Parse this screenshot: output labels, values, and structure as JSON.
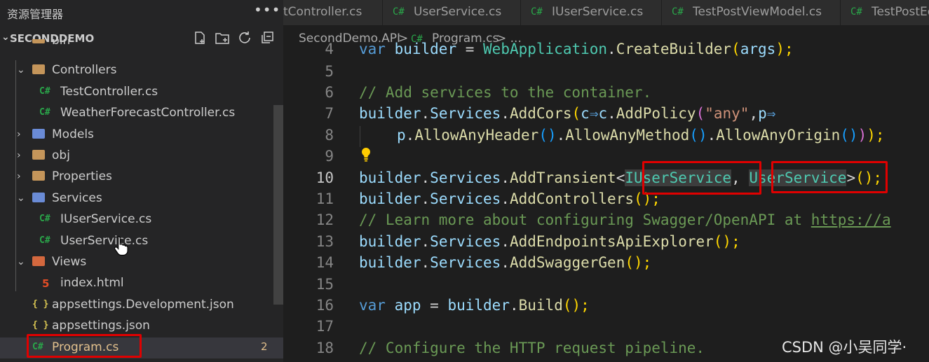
{
  "explorer": {
    "title": "资源管理器",
    "more_icon": "•••",
    "project": "SECONDDEMO",
    "header_icons": [
      "new-file-icon",
      "new-folder-icon",
      "refresh-icon",
      "collapse-all-icon"
    ],
    "items": [
      {
        "label": "bin",
        "type": "folder"
      },
      {
        "label": "Controllers",
        "type": "folder"
      },
      {
        "label": "TestController.cs",
        "type": "cs"
      },
      {
        "label": "WeatherForecastController.cs",
        "type": "cs"
      },
      {
        "label": "Models",
        "type": "folder"
      },
      {
        "label": "obj",
        "type": "folder"
      },
      {
        "label": "Properties",
        "type": "folder"
      },
      {
        "label": "Services",
        "type": "folder"
      },
      {
        "label": "IUserService.cs",
        "type": "cs"
      },
      {
        "label": "UserService.cs",
        "type": "cs"
      },
      {
        "label": "Views",
        "type": "folder"
      },
      {
        "label": "index.html",
        "type": "html"
      },
      {
        "label": "appsettings.Development.json",
        "type": "json"
      },
      {
        "label": "appsettings.json",
        "type": "json"
      },
      {
        "label": "Program.cs",
        "type": "cs",
        "badge": "2"
      }
    ],
    "cs_glyph": "C#",
    "json_glyph": "{ }",
    "html_glyph": "5"
  },
  "tabs": [
    {
      "label": "tController.cs"
    },
    {
      "label": "UserService.cs"
    },
    {
      "label": "IUserService.cs"
    },
    {
      "label": "TestPostViewModel.cs"
    },
    {
      "label": "TestPostEd"
    }
  ],
  "breadcrumb": {
    "project": "SecondDemo.API",
    "sep": ">",
    "file": "Program.cs",
    "tail": "> ..."
  },
  "editor": {
    "line_numbers": [
      "4",
      "5",
      "6",
      "7",
      "8",
      "9",
      "10",
      "11",
      "12",
      "13",
      "14",
      "15",
      "16",
      "17",
      "18"
    ],
    "current_line": "10",
    "l4": [
      "var",
      " builder ",
      "=",
      " WebApplication",
      ".",
      "CreateBuilder",
      "(",
      "args",
      ");"
    ],
    "l6": "// Add services to the container.",
    "l7": [
      "builder",
      ".",
      "Services",
      ".",
      "AddCors",
      "(",
      "c",
      "⇒",
      "c",
      ".",
      "AddPolicy",
      "(",
      "\"any\"",
      ",",
      "p",
      "⇒"
    ],
    "l8": [
      "p",
      ".",
      "AllowAnyHeader",
      "()",
      ".",
      "AllowAnyMethod",
      "()",
      ".",
      "AllowAnyOrigin",
      "()",
      ")",
      ");"
    ],
    "l10": [
      "builder",
      ".",
      "Services",
      ".",
      "AddTransient",
      "<",
      "IUserService",
      ", ",
      "UserService",
      ">",
      "();"
    ],
    "l11": [
      "builder",
      ".",
      "Services",
      ".",
      "AddControllers",
      "();"
    ],
    "l12": [
      "// Learn more about configuring Swagger/OpenAPI at ",
      "https://a"
    ],
    "l13": [
      "builder",
      ".",
      "Services",
      ".",
      "AddEndpointsApiExplorer",
      "();"
    ],
    "l14": [
      "builder",
      ".",
      "Services",
      ".",
      "AddSwaggerGen",
      "();"
    ],
    "l16": [
      "var",
      " app ",
      "=",
      " builder",
      ".",
      "Build",
      "();"
    ],
    "l18": "// Configure the HTTP request pipeline."
  },
  "watermark": "CSDN @小吴同学·"
}
